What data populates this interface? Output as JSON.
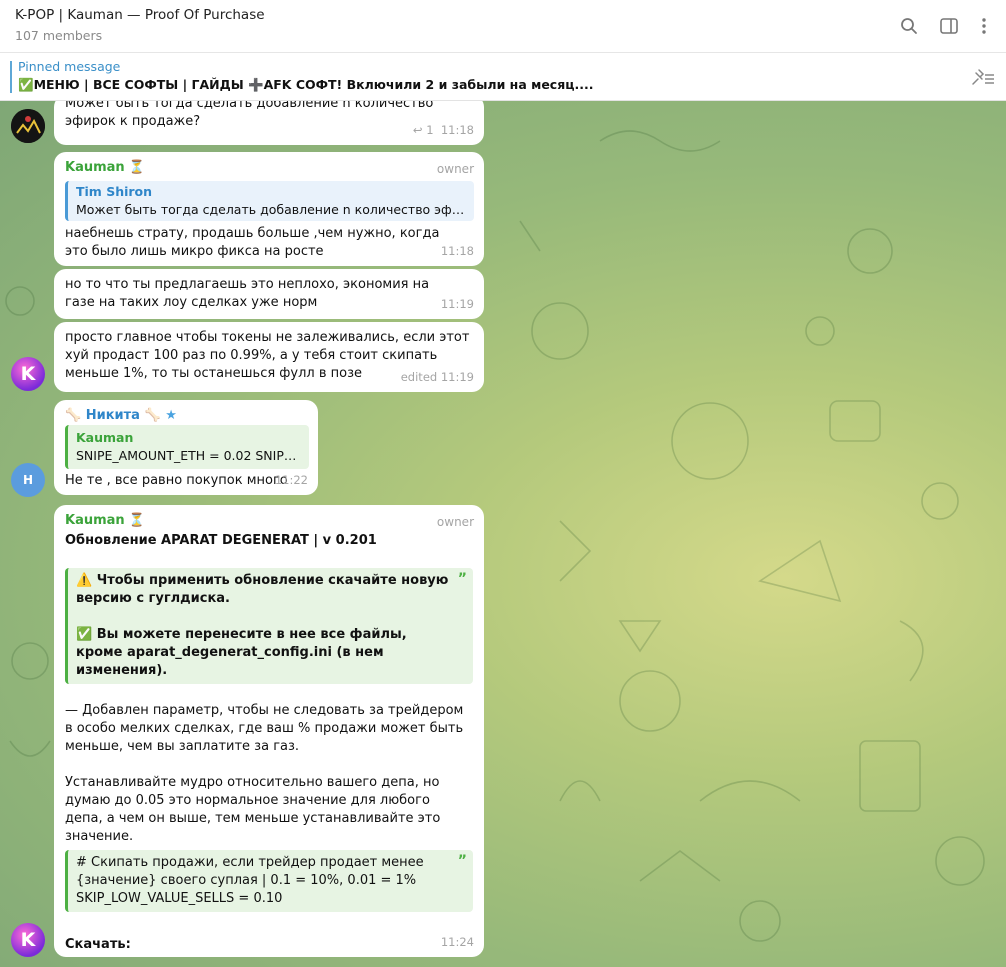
{
  "header": {
    "title": "K-POP | Kauman — Proof Of Purchase",
    "members": "107 members"
  },
  "pinned": {
    "label": "Pinned message",
    "text": "✅МЕНЮ | ВСЕ СОФТЫ | ГАЙДЫ  ➕AFK СОФТ! Включили 2 и забыли на месяц...."
  },
  "messages": {
    "m1": {
      "text": "Может быть тогда сделать добавление n количество эфирок к продаже?",
      "replies": "1",
      "time": "11:18"
    },
    "m2": {
      "author": "Kauman",
      "role": "owner",
      "quote_author": "Tim Shiron",
      "quote_text": "Может быть тогда сделать добавление n количество эфирок ...",
      "text": "наебнешь страту, продашь больше ,чем нужно, когда это было лишь микро фикса на росте",
      "time": "11:18"
    },
    "m3": {
      "text": "но то что ты предлагаешь это неплохо, экономия на газе на таких лоу сделках уже норм",
      "time": "11:19"
    },
    "m4": {
      "text": "просто главное чтобы токены не залеживались, если этот хуй продаст 100 раз по 0.99%, а у тебя стоит скипать меньше 1%, то ты останешься фулл в позе",
      "time": "edited 11:19"
    },
    "m5": {
      "author": "Никита",
      "avatar_letter": "H",
      "quote_author": "Kauman",
      "quote_text": "SNIPE_AMOUNT_ETH = 0.02 SNIPE_...",
      "text": "Не те , все равно покупок много",
      "time": "11:22"
    },
    "m6": {
      "author": "Kauman",
      "role": "owner",
      "heading": "Обновление APARAT DEGENERAT | v 0.201",
      "quote1_line1": "⚠️ Чтобы применить обновление скачайте новую версию с гуглдиска.",
      "quote1_line2": "✅ Вы можете перенесите в нее все файлы, кроме aparat_degenerat_config.ini (в нем изменения).",
      "para1": "— Добавлен параметр, чтобы не следовать за трейдером в особо мелких сделках, где ваш % продажи может быть меньше, чем вы заплатите за газ.",
      "para2": "Устанавливайте мудро относительно вашего депа, но думаю до 0.05 это нормальное значение для любого депа, а чем он выше, тем меньше устанавливайте это значение.",
      "code_line1": "# Скипать продажи, если трейдер продает менее {значение} своего суплая | 0.1 = 10%, 0.01 = 1%",
      "code_line2": "SKIP_LOW_VALUE_SELLS = 0.10",
      "download": "Скачать:",
      "time": "11:24"
    }
  },
  "colors": {
    "accent": "#3ba33a",
    "link": "#2f86c9",
    "bubble": "#ffffff"
  }
}
